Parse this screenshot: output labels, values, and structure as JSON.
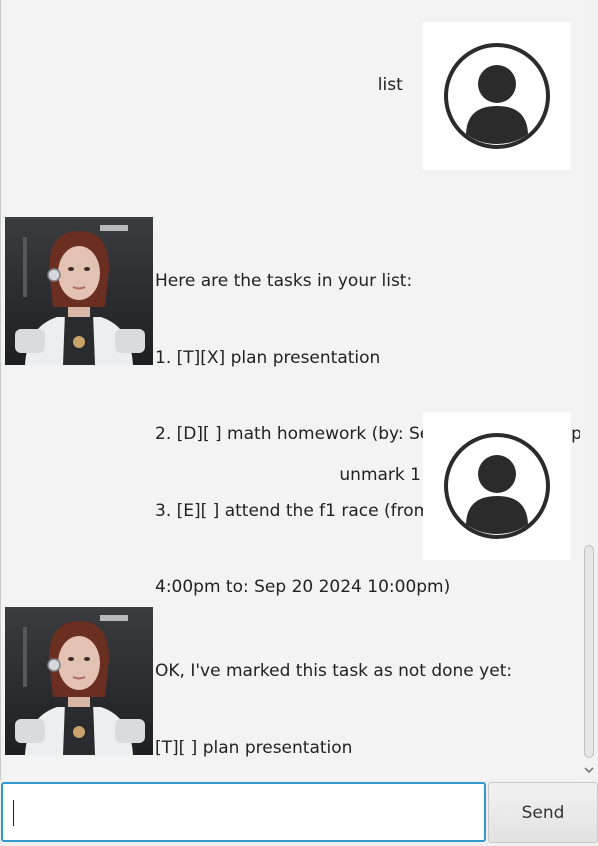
{
  "messages": [
    {
      "sender": "user",
      "lines": [
        "list"
      ]
    },
    {
      "sender": "bot",
      "lines": [
        "Here are the tasks in your list:",
        "1. [T][X] plan presentation",
        "2. [D][ ] math homework (by: Sep 20 2024 11:59pm)",
        "3. [E][ ] attend the f1 race (from: Sep 20 2024",
        "4:00pm to: Sep 20 2024 10:00pm)"
      ]
    },
    {
      "sender": "user",
      "lines": [
        "unmark 1"
      ]
    },
    {
      "sender": "bot",
      "lines": [
        "OK, I've marked this task as not done yet:",
        "[T][ ] plan presentation"
      ]
    }
  ],
  "input": {
    "value": "",
    "placeholder": ""
  },
  "send_button": {
    "label": "Send"
  },
  "icons": {
    "user_avatar": "user-avatar-icon",
    "bot_avatar": "bot-avatar-image",
    "scroll_down": "chevron-down-icon"
  },
  "colors": {
    "input_focus_border": "#3399cc",
    "background": "#f3f3f3",
    "avatar_icon": "#2b2b2b"
  }
}
